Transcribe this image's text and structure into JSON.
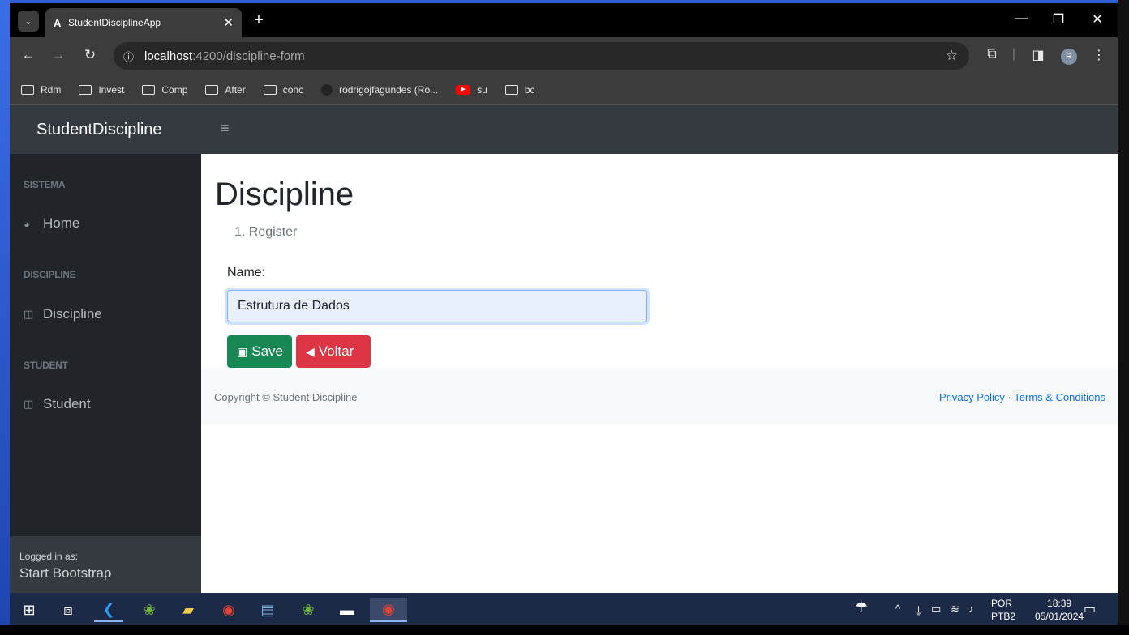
{
  "browser": {
    "tab_title": "StudentDisciplineApp",
    "tab_favicon": "A",
    "url_host": "localhost",
    "url_path": ":4200/discipline-form",
    "bookmarks": [
      "Rdm",
      "Invest",
      "Comp",
      "After",
      "conc",
      "rodrigojfagundes (Ro...",
      "su",
      "bc"
    ],
    "profile_initial": "R"
  },
  "app": {
    "brand": "StudentDiscipline",
    "sidebar": {
      "sections": [
        {
          "heading": "SISTEMA",
          "link": "Home",
          "icon": "dashboard-icon"
        },
        {
          "heading": "DISCIPLINE",
          "link": "Discipline",
          "icon": "table-icon"
        },
        {
          "heading": "STUDENT",
          "link": "Student",
          "icon": "table-icon"
        }
      ],
      "footer_small": "Logged in as:",
      "footer_name": "Start Bootstrap"
    },
    "page_title": "Discipline",
    "breadcrumb": "1. Register",
    "form": {
      "name_label": "Name:",
      "name_value": "Estrutura de Dados",
      "save_label": "Save",
      "back_label": "Voltar"
    },
    "footer": {
      "copyright": "Copyright © Student Discipline",
      "privacy": "Privacy Policy",
      "separator": "·",
      "terms": "Terms & Conditions"
    }
  },
  "taskbar": {
    "lang_top": "POR",
    "lang_bottom": "PTB2",
    "time": "18:39",
    "date": "05/01/2024"
  },
  "colors": {
    "save": "#198754",
    "back": "#dc3545",
    "sidebar": "#212529",
    "topbar": "#343a40",
    "link": "#0d6efd"
  }
}
